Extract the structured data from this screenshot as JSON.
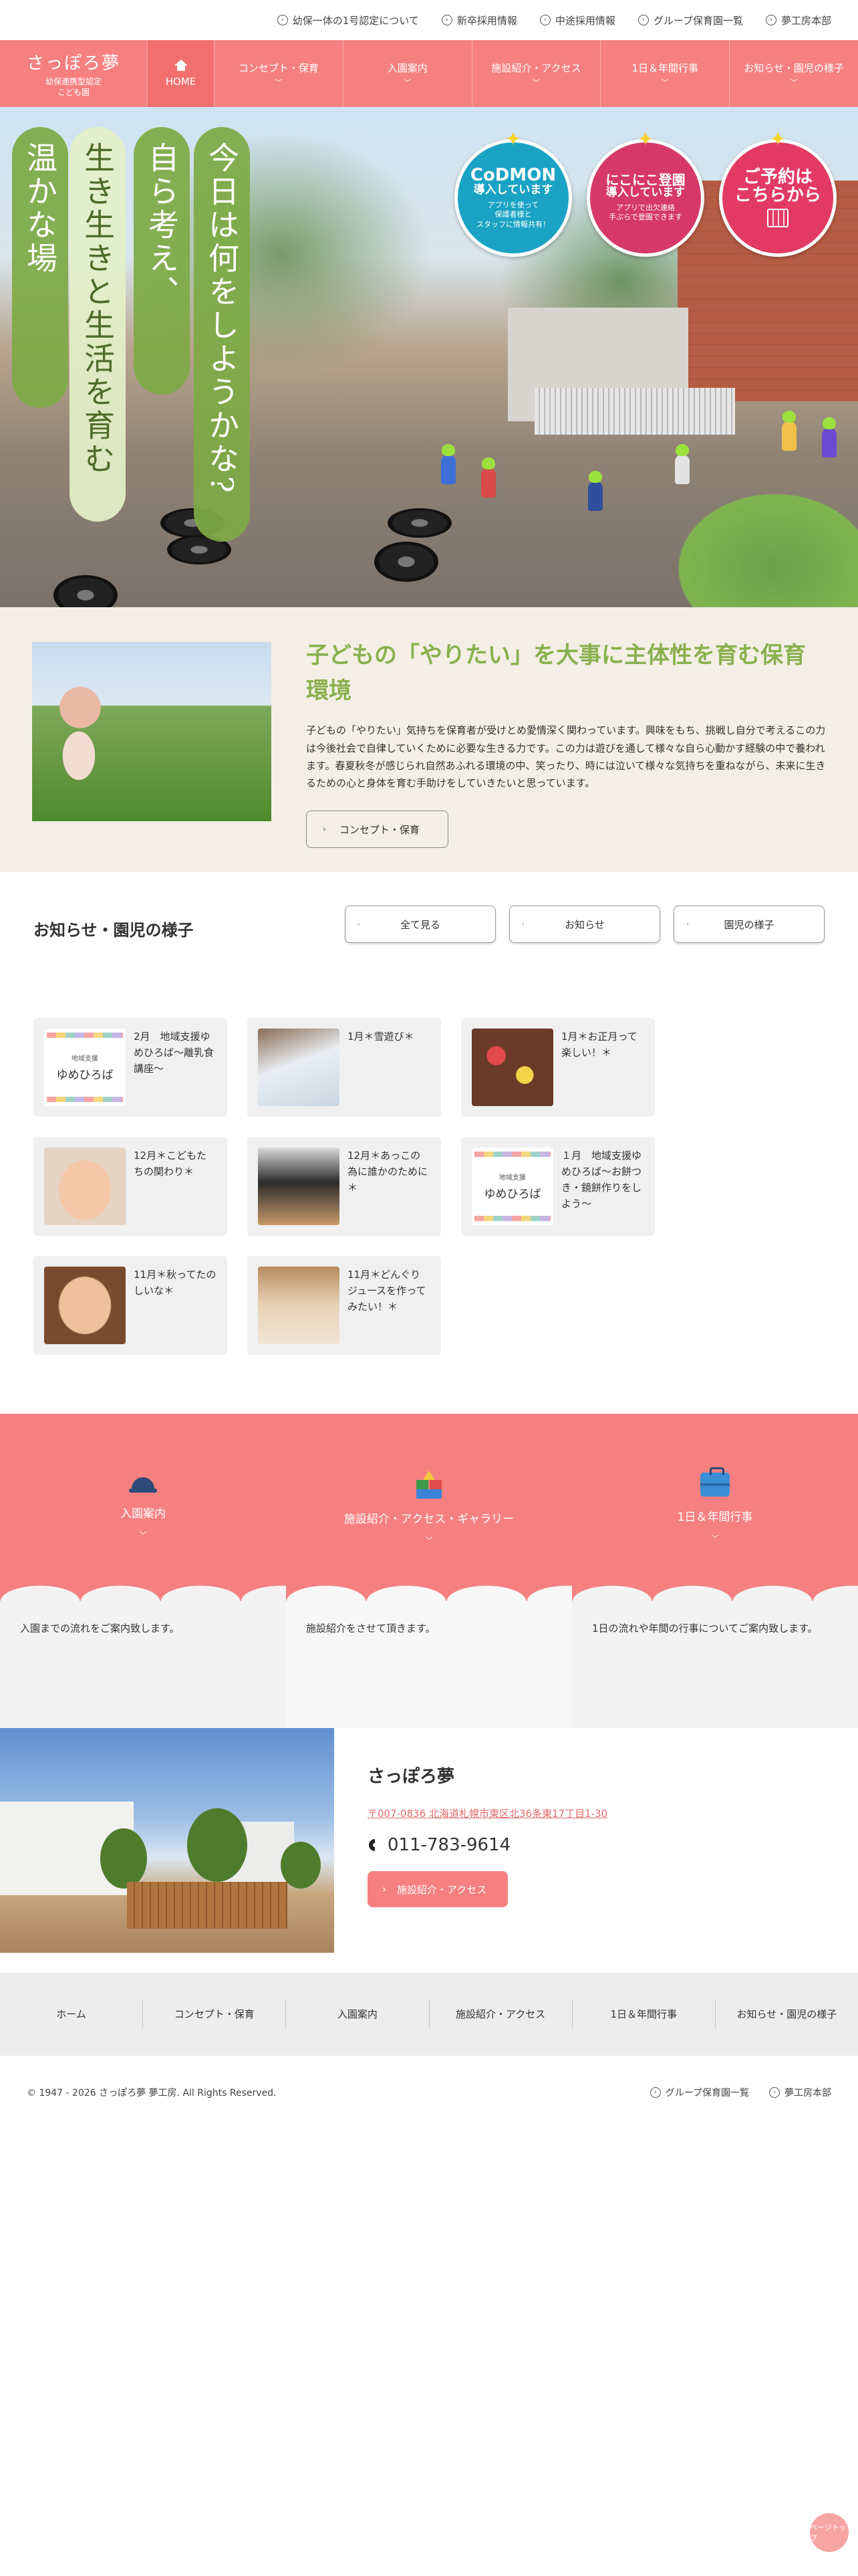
{
  "topbar": {
    "links": [
      {
        "label": "幼保一体の1号認定について"
      },
      {
        "label": "新卒採用情報"
      },
      {
        "label": "中途採用情報"
      },
      {
        "label": "グループ保育園一覧"
      },
      {
        "label": "夢工房本部"
      }
    ]
  },
  "header": {
    "logo_name": "さっぽろ夢",
    "logo_sub1": "幼保連携型認定",
    "logo_sub2": "こども園",
    "home_label": "HOME",
    "nav": [
      {
        "label": "コンセプト・保育"
      },
      {
        "label": "入園案内"
      },
      {
        "label": "施設紹介・アクセス"
      },
      {
        "label": "1日＆年間行事"
      },
      {
        "label": "お知らせ・園児の様子"
      }
    ]
  },
  "hero": {
    "taglines": [
      "今日は何をしようかな?",
      "自ら考え、",
      "生き生きと生活を育む",
      "温かな場"
    ],
    "badges": {
      "codmon": {
        "title1": "CoDMON",
        "title2": "導入しています",
        "sub1": "アプリを使って",
        "sub2": "保護者様と",
        "sub3": "スタッフに情報共有！"
      },
      "nikoniko": {
        "title1": "にこにこ登園",
        "title2": "導入しています",
        "sub1": "アプリで出欠連絡",
        "sub2": "手ぶらで登園できます"
      },
      "reserve": {
        "title1": "ご予約は",
        "title2": "こちらから"
      }
    }
  },
  "intro": {
    "title": "子どもの「やりたい」を大事に主体性を育む保育環境",
    "text": "子どもの「やりたい」気持ちを保育者が受けとめ愛情深く関わっています。興味をもち、挑戦し自分で考えるこの力は今後社会で自律していくために必要な生きる力です。この力は遊びを通して様々な自ら心動かす経験の中で養われます。春夏秋冬が感じられ自然あふれる環境の中、笑ったり、時には泣いて様々な気持ちを重ねながら、未来に生きるための心と身体を育む手助けをしていきたいと思っています。",
    "button_label": "コンセプト・保育"
  },
  "news": {
    "title": "お知らせ・園児の様子",
    "filters": [
      {
        "label": "全て見る"
      },
      {
        "label": "お知らせ"
      },
      {
        "label": "園児の様子"
      }
    ],
    "thumb_card": {
      "small": "地域支援",
      "big": "ゆめひろば"
    },
    "items": [
      {
        "title": "2月　地域支援ゆめひろば～離乳食講座～"
      },
      {
        "title": "1月＊雪遊び＊"
      },
      {
        "title": "1月＊お正月って楽しい！＊"
      },
      {
        "title": "12月＊こどもたちの関わり＊"
      },
      {
        "title": "12月＊あっこの為に誰かのために＊"
      },
      {
        "title": "１月　地域支援ゆめひろば～お餅つき・鏡餅作りをしよう～"
      },
      {
        "title": "11月＊秋ってたのしいな＊"
      },
      {
        "title": "11月＊どんぐりジュースを作ってみたい！＊"
      }
    ]
  },
  "info": [
    {
      "label": "入園案内",
      "text": "入園までの流れをご案内致します。"
    },
    {
      "label": "施設紹介・アクセス・ギャラリー",
      "text": "施設紹介をさせて頂きます。"
    },
    {
      "label": "1日＆年間行事",
      "text": "1日の流れや年間の行事についてご案内致します。"
    }
  ],
  "facility": {
    "name": "さっぽろ夢",
    "address": "〒007-0836 北海道札幌市東区北36条東17丁目1-30",
    "tel": "011-783-9614",
    "button_label": "施設紹介・アクセス"
  },
  "footer": {
    "nav": [
      {
        "label": "ホーム"
      },
      {
        "label": "コンセプト・保育"
      },
      {
        "label": "入園案内"
      },
      {
        "label": "施設紹介・アクセス"
      },
      {
        "label": "1日＆年間行事"
      },
      {
        "label": "お知らせ・園児の様子"
      }
    ],
    "copyright": "© 1947 - 2026 さっぽろ夢 夢工房. All Rights Reserved.",
    "links": [
      {
        "label": "グループ保育園一覧"
      },
      {
        "label": "夢工房本部"
      }
    ],
    "pagetop_label": "ページトップ"
  },
  "colors": {
    "brand_pink": "#f68080",
    "accent_green": "#8ab04e",
    "intro_bg": "#f3efe4"
  }
}
